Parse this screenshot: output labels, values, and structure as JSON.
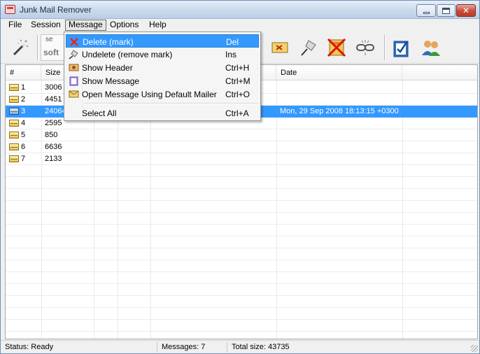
{
  "window": {
    "title": "Junk Mail Remover"
  },
  "menubar": {
    "items": [
      {
        "label": "File"
      },
      {
        "label": "Session"
      },
      {
        "label": "Message"
      },
      {
        "label": "Options"
      },
      {
        "label": "Help"
      }
    ]
  },
  "toolbar": {
    "combo_line1": "se",
    "combo_line2": "soft",
    "buttons": [
      {
        "icon": "magic-wand-icon"
      },
      {
        "icon": "delete-mark-icon"
      },
      {
        "icon": "pin-icon"
      },
      {
        "icon": "delete-all-icon"
      },
      {
        "icon": "unlink-icon"
      },
      {
        "icon": "checklist-icon"
      },
      {
        "icon": "users-icon"
      }
    ]
  },
  "list": {
    "columns": {
      "num": "#",
      "size": "Size",
      "date": "Date"
    },
    "rows": [
      {
        "num": "1",
        "size": "3006",
        "date": "",
        "selected": false
      },
      {
        "num": "2",
        "size": "4451",
        "date": "",
        "selected": false
      },
      {
        "num": "3",
        "size": "24064",
        "date": "Mon, 29 Sep 2008 18:13:15 +0300",
        "selected": true
      },
      {
        "num": "4",
        "size": "2595",
        "date": "",
        "selected": false
      },
      {
        "num": "5",
        "size": "850",
        "date": "",
        "selected": false
      },
      {
        "num": "6",
        "size": "6636",
        "date": "",
        "selected": false
      },
      {
        "num": "7",
        "size": "2133",
        "date": "",
        "selected": false
      }
    ]
  },
  "message_menu": {
    "items": [
      {
        "label": "Delete (mark)",
        "shortcut": "Del",
        "icon": "red-x-icon",
        "highlighted": true
      },
      {
        "label": "Undelete (remove mark)",
        "shortcut": "Ins",
        "icon": "undelete-icon",
        "highlighted": false
      },
      {
        "label": "Show Header",
        "shortcut": "Ctrl+H",
        "icon": "header-icon",
        "highlighted": false
      },
      {
        "label": "Show Message",
        "shortcut": "Ctrl+M",
        "icon": "message-icon",
        "highlighted": false
      },
      {
        "label": "Open Message Using Default Mailer",
        "shortcut": "Ctrl+O",
        "icon": "envelope-icon",
        "highlighted": false
      },
      {
        "label": "Select All",
        "shortcut": "Ctrl+A",
        "icon": "",
        "highlighted": false
      }
    ]
  },
  "statusbar": {
    "status": "Status: Ready",
    "messages": "Messages: 7",
    "total": "Total size: 43735"
  },
  "colors": {
    "selection": "#3399ff",
    "titlebar": "#cad9ec"
  }
}
